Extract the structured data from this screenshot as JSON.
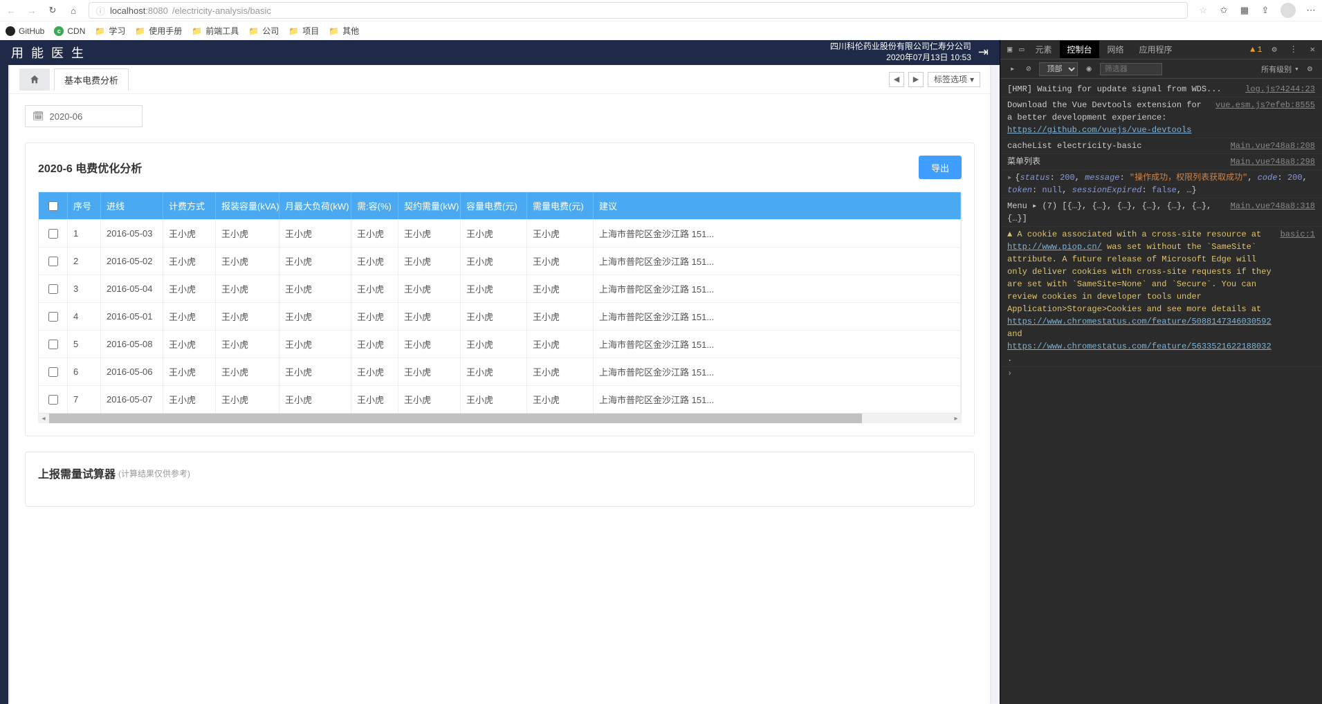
{
  "browser": {
    "url_host": "localhost",
    "url_port": ":8080",
    "url_path": "/electricity-analysis/basic",
    "bookmarks": [
      "GitHub",
      "CDN",
      "学习",
      "使用手册",
      "前端工具",
      "公司",
      "项目",
      "其他"
    ]
  },
  "app": {
    "title": "用 能 医 生",
    "company": "四川科伦药业股份有限公司仁寿分公司",
    "datetime": "2020年07月13日 10:53",
    "home_tab": "首页",
    "tabs": [
      {
        "label": "基本电费分析",
        "active": true
      }
    ],
    "nav_prev": "◀",
    "nav_next": "▶",
    "tag_options_label": "标签选项",
    "date_value": "2020-06",
    "panel1_title": "2020-6 电费优化分析",
    "export_label": "导出",
    "columns": [
      "序号",
      "进线",
      "计费方式",
      "报装容量(kVA)",
      "月最大负荷(kW)",
      "需:容(%)",
      "契约需量(kW)",
      "容量电费(元)",
      "需量电费(元)",
      "建议"
    ],
    "rows": [
      {
        "idx": "1",
        "line": "2016-05-03",
        "mode": "王小虎",
        "cap": "王小虎",
        "load": "王小虎",
        "rate": "王小虎",
        "agree": "王小虎",
        "capfee": "王小虎",
        "demfee": "王小虎",
        "sugg": "上海市普陀区金沙江路 151..."
      },
      {
        "idx": "2",
        "line": "2016-05-02",
        "mode": "王小虎",
        "cap": "王小虎",
        "load": "王小虎",
        "rate": "王小虎",
        "agree": "王小虎",
        "capfee": "王小虎",
        "demfee": "王小虎",
        "sugg": "上海市普陀区金沙江路 151..."
      },
      {
        "idx": "3",
        "line": "2016-05-04",
        "mode": "王小虎",
        "cap": "王小虎",
        "load": "王小虎",
        "rate": "王小虎",
        "agree": "王小虎",
        "capfee": "王小虎",
        "demfee": "王小虎",
        "sugg": "上海市普陀区金沙江路 151..."
      },
      {
        "idx": "4",
        "line": "2016-05-01",
        "mode": "王小虎",
        "cap": "王小虎",
        "load": "王小虎",
        "rate": "王小虎",
        "agree": "王小虎",
        "capfee": "王小虎",
        "demfee": "王小虎",
        "sugg": "上海市普陀区金沙江路 151..."
      },
      {
        "idx": "5",
        "line": "2016-05-08",
        "mode": "王小虎",
        "cap": "王小虎",
        "load": "王小虎",
        "rate": "王小虎",
        "agree": "王小虎",
        "capfee": "王小虎",
        "demfee": "王小虎",
        "sugg": "上海市普陀区金沙江路 151..."
      },
      {
        "idx": "6",
        "line": "2016-05-06",
        "mode": "王小虎",
        "cap": "王小虎",
        "load": "王小虎",
        "rate": "王小虎",
        "agree": "王小虎",
        "capfee": "王小虎",
        "demfee": "王小虎",
        "sugg": "上海市普陀区金沙江路 151..."
      },
      {
        "idx": "7",
        "line": "2016-05-07",
        "mode": "王小虎",
        "cap": "王小虎",
        "load": "王小虎",
        "rate": "王小虎",
        "agree": "王小虎",
        "capfee": "王小虎",
        "demfee": "王小虎",
        "sugg": "上海市普陀区金沙江路 151..."
      }
    ],
    "panel2_title": "上报需量试算器",
    "panel2_note": "(计算结果仅供参考)"
  },
  "devtools": {
    "tabs": [
      "元素",
      "控制台",
      "网络",
      "应用程序"
    ],
    "active_tab": "控制台",
    "warn_count": "1",
    "top_label": "顶部",
    "filter_placeholder": "筛选器",
    "level_label": "所有级别",
    "logs": [
      {
        "type": "plain",
        "msg": "[HMR] Waiting for update signal from WDS...",
        "src": "log.js?4244:23"
      },
      {
        "type": "mixed",
        "pre": "Download the Vue Devtools extension for a better development experience:",
        "link": "https://github.com/vuejs/vue-devtools",
        "src": "vue.esm.js?efeb:8555"
      },
      {
        "type": "plain",
        "msg": "cacheList electricity-basic",
        "src": "Main.vue?48a8:208"
      },
      {
        "type": "plain",
        "msg": "菜单列表",
        "src": "Main.vue?48a8:298"
      },
      {
        "type": "obj",
        "status": "200",
        "message": "操作成功，权限列表获取成功",
        "code": "200",
        "token": "null",
        "sessionExpired": "false",
        "src": ""
      },
      {
        "type": "plain",
        "msg": "Menu ▸ (7) [{…}, {…}, {…}, {…}, {…}, {…}, {…}]",
        "src": "Main.vue?48a8:318"
      },
      {
        "type": "warn",
        "pre": "A cookie associated with a cross-site resource at ",
        "link1": "http://www.piop.cn/",
        "mid": " was set without the `SameSite` attribute. A future release of Microsoft Edge will only deliver cookies with cross-site requests if they are set with `SameSite=None` and `Secure`. You can review cookies in developer tools under Application>Storage>Cookies and see more details at ",
        "link2": "https://www.chromestatus.com/feature/5088147346030592",
        "and": " and ",
        "link3": "https://www.chromestatus.com/feature/5633521622188032",
        "end": ".",
        "src": "basic:1"
      }
    ]
  }
}
